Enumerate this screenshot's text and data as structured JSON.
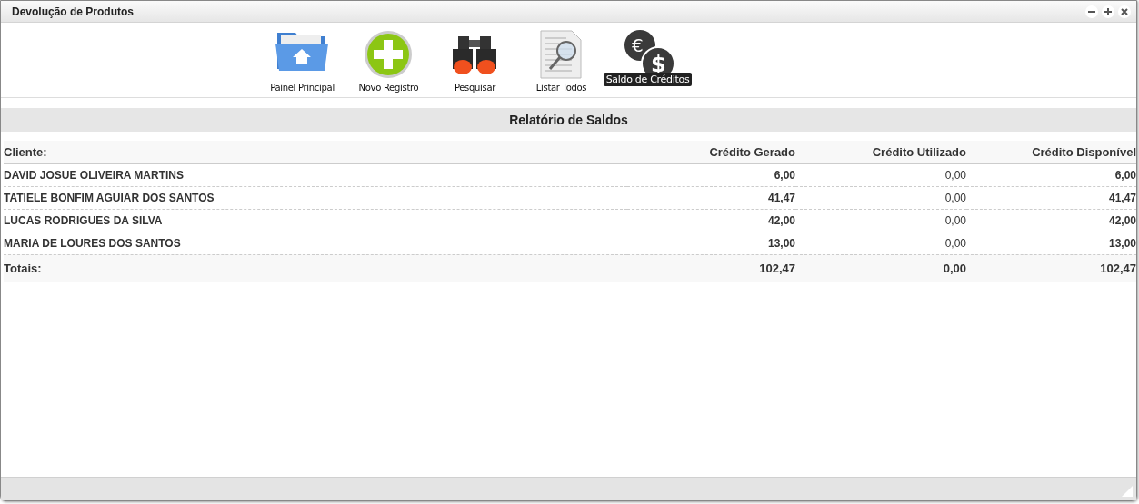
{
  "window": {
    "title": "Devolução de Produtos"
  },
  "toolbar": [
    {
      "label": "Painel Principal",
      "hovered": false
    },
    {
      "label": "Novo Registro",
      "hovered": false
    },
    {
      "label": "Pesquisar",
      "hovered": false
    },
    {
      "label": "Listar Todos",
      "hovered": false
    },
    {
      "label": "Saldo de Créditos",
      "hovered": true,
      "glyphs": [
        "€",
        "$"
      ]
    }
  ],
  "report": {
    "title": "Relatório de Saldos",
    "columns": [
      "Cliente:",
      "Crédito Gerado",
      "Crédito Utilizado",
      "Crédito Disponível"
    ],
    "rows": [
      [
        "DAVID JOSUE OLIVEIRA MARTINS",
        "6,00",
        "0,00",
        "6,00"
      ],
      [
        "TATIELE BONFIM AGUIAR DOS SANTOS",
        "41,47",
        "0,00",
        "41,47"
      ],
      [
        "LUCAS RODRIGUES DA SILVA",
        "42,00",
        "0,00",
        "42,00"
      ],
      [
        "MARIA DE LOURES DOS SANTOS",
        "13,00",
        "0,00",
        "13,00"
      ]
    ],
    "totals": [
      "Totais:",
      "102,47",
      "0,00",
      "102,47"
    ]
  }
}
